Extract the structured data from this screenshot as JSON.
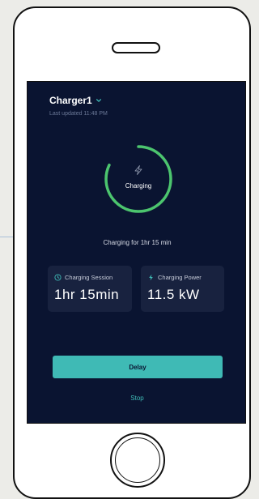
{
  "header": {
    "charger_name": "Charger1",
    "last_updated": "Last updated 11:48 PM"
  },
  "status": {
    "ring_label": "Charging",
    "ring_progress": 0.82,
    "duration_text": "Charging for 1hr 15 min"
  },
  "cards": {
    "session": {
      "label": "Charging Session",
      "value": "1hr 15min",
      "icon": "clock-icon"
    },
    "power": {
      "label": "Charging Power",
      "value": "11.5 kW",
      "icon": "lightning-bolt-icon"
    }
  },
  "actions": {
    "delay_label": "Delay",
    "stop_label": "Stop"
  },
  "colors": {
    "screen_bg": "#0a1431",
    "accent": "#3fbab5",
    "ring_green": "#4cc56e",
    "card_bg": "#18223f"
  }
}
